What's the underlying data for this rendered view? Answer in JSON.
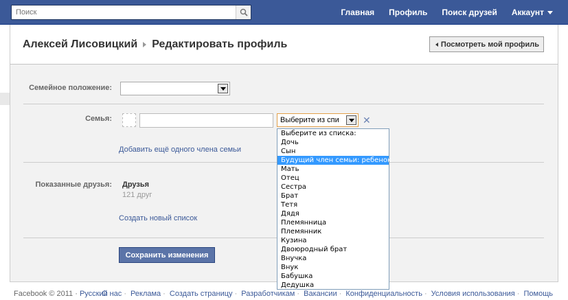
{
  "topbar": {
    "search_placeholder": "Поиск",
    "nav": [
      "Главная",
      "Профиль",
      "Поиск друзей",
      "Аккаунт"
    ]
  },
  "header": {
    "name": "Алексей Лисовицкий",
    "section": "Редактировать профиль",
    "view_profile_button": "Посмотреть мой профиль"
  },
  "form": {
    "relationship_label": "Семейное положение:",
    "relationship_value": "",
    "family_label": "Семья:",
    "family_name_value": "",
    "family_select_value": "Выберите из спи",
    "add_family_link": "Добавить ещё одного члена семьи",
    "shown_friends_label": "Показанные друзья:",
    "friends_title": "Друзья",
    "friends_count": "121 друг",
    "create_list_link": "Создать новый список",
    "save_button": "Сохранить изменения"
  },
  "dropdown": {
    "selected_index": 3,
    "options": [
      "Выберите из списка:",
      "Дочь",
      "Сын",
      "Будущий член семьи: ребенок",
      "Мать",
      "Отец",
      "Сестра",
      "Брат",
      "Тетя",
      "Дядя",
      "Племянница",
      "Племянник",
      "Кузина",
      "Двоюродный брат",
      "Внучка",
      "Внук",
      "Бабушка",
      "Дедушка"
    ]
  },
  "footer": {
    "copyright": "Facebook © 2011 ·",
    "language": "Русский",
    "links": [
      "О нас",
      "Реклама",
      "Создать страницу",
      "Разработчикам",
      "Вакансии",
      "Конфиденциальность",
      "Условия использования",
      "Помощь"
    ]
  },
  "colors": {
    "brand": "#3b5998",
    "selection": "#3399ff"
  }
}
